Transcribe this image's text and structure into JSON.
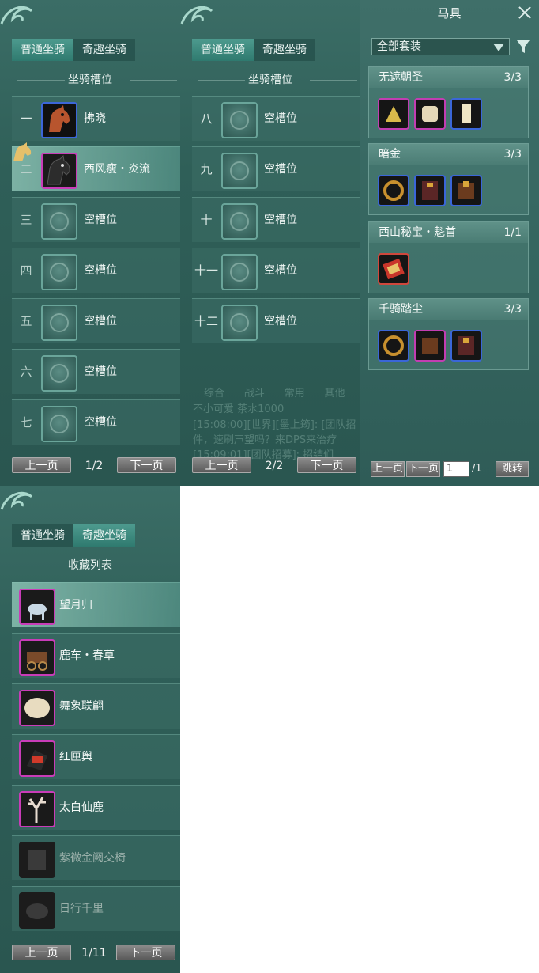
{
  "panel_normal_1": {
    "tabs": [
      "普通坐骑",
      "奇趣坐骑"
    ],
    "active_tab": 0,
    "section_title": "坐骑槽位",
    "slots": [
      {
        "num": "一",
        "name": "拂晓",
        "icon": "red-horse-icon",
        "filled": true
      },
      {
        "num": "二",
        "name": "西风瘦・炎流",
        "icon": "black-horse-icon",
        "filled": true,
        "selected": true
      },
      {
        "num": "三",
        "name": "空槽位",
        "icon": "empty-slot-icon",
        "filled": false
      },
      {
        "num": "四",
        "name": "空槽位",
        "icon": "empty-slot-icon",
        "filled": false
      },
      {
        "num": "五",
        "name": "空槽位",
        "icon": "empty-slot-icon",
        "filled": false
      },
      {
        "num": "六",
        "name": "空槽位",
        "icon": "empty-slot-icon",
        "filled": false
      },
      {
        "num": "七",
        "name": "空槽位",
        "icon": "empty-slot-icon",
        "filled": false
      }
    ],
    "prev": "上一页",
    "page": "1/2",
    "next": "下一页"
  },
  "panel_normal_2": {
    "tabs": [
      "普通坐骑",
      "奇趣坐骑"
    ],
    "active_tab": 0,
    "section_title": "坐骑槽位",
    "slots": [
      {
        "num": "八",
        "name": "空槽位"
      },
      {
        "num": "九",
        "name": "空槽位"
      },
      {
        "num": "十",
        "name": "空槽位"
      },
      {
        "num": "十一",
        "name": "空槽位"
      },
      {
        "num": "十二",
        "name": "空槽位"
      }
    ],
    "chat_tabs": [
      "综合",
      "战斗",
      "常用",
      "其他"
    ],
    "chat_lines": [
      "不小可爱 茶水1000",
      "[15:08:00][世界][墨上筠]: [团队招",
      "件，速刷声望吗？来DPS来治疗",
      "[15:09:01][团队招募]: 招结们"
    ],
    "prev": "上一页",
    "page": "2/2",
    "next": "下一页"
  },
  "panel_gear": {
    "title": "马具",
    "filter_select": "全部套装",
    "sets": [
      {
        "name": "无遮朝圣",
        "count": "3/3",
        "items": [
          "blue",
          "purple",
          "blue"
        ]
      },
      {
        "name": "暗金",
        "count": "3/3",
        "items": [
          "blue",
          "blue",
          "blue"
        ]
      },
      {
        "name": "西山秘宝・魁首",
        "count": "1/1",
        "items": [
          "red"
        ]
      },
      {
        "name": "千骑踏尘",
        "count": "3/3",
        "items": [
          "blue",
          "purple",
          "blue"
        ]
      }
    ],
    "prev": "上一页",
    "next": "下一页",
    "page_input": "1",
    "page_total": "/1",
    "jump": "跳转"
  },
  "panel_fun": {
    "tabs": [
      "普通坐骑",
      "奇趣坐骑"
    ],
    "active_tab": 1,
    "section_title": "收藏列表",
    "items": [
      {
        "name": "望月归",
        "icon": "moon-deer-icon",
        "selected": true
      },
      {
        "name": "鹿车・春草",
        "icon": "deer-cart-icon"
      },
      {
        "name": "舞象联翩",
        "icon": "elephant-icon"
      },
      {
        "name": "红匣舆",
        "icon": "red-box-carriage-icon"
      },
      {
        "name": "太白仙鹿",
        "icon": "antler-deer-icon"
      },
      {
        "name": "紫微金阙交椅",
        "icon": "chair-icon",
        "locked": true
      },
      {
        "name": "日行千里",
        "icon": "swift-horse-icon",
        "locked": true
      }
    ],
    "prev": "上一页",
    "page": "1/11",
    "next": "下一页"
  },
  "colors": {
    "accent": "#2f7a6f",
    "panel": "#2f5f58",
    "epic": "#c23db2",
    "rare": "#3a66d8"
  }
}
